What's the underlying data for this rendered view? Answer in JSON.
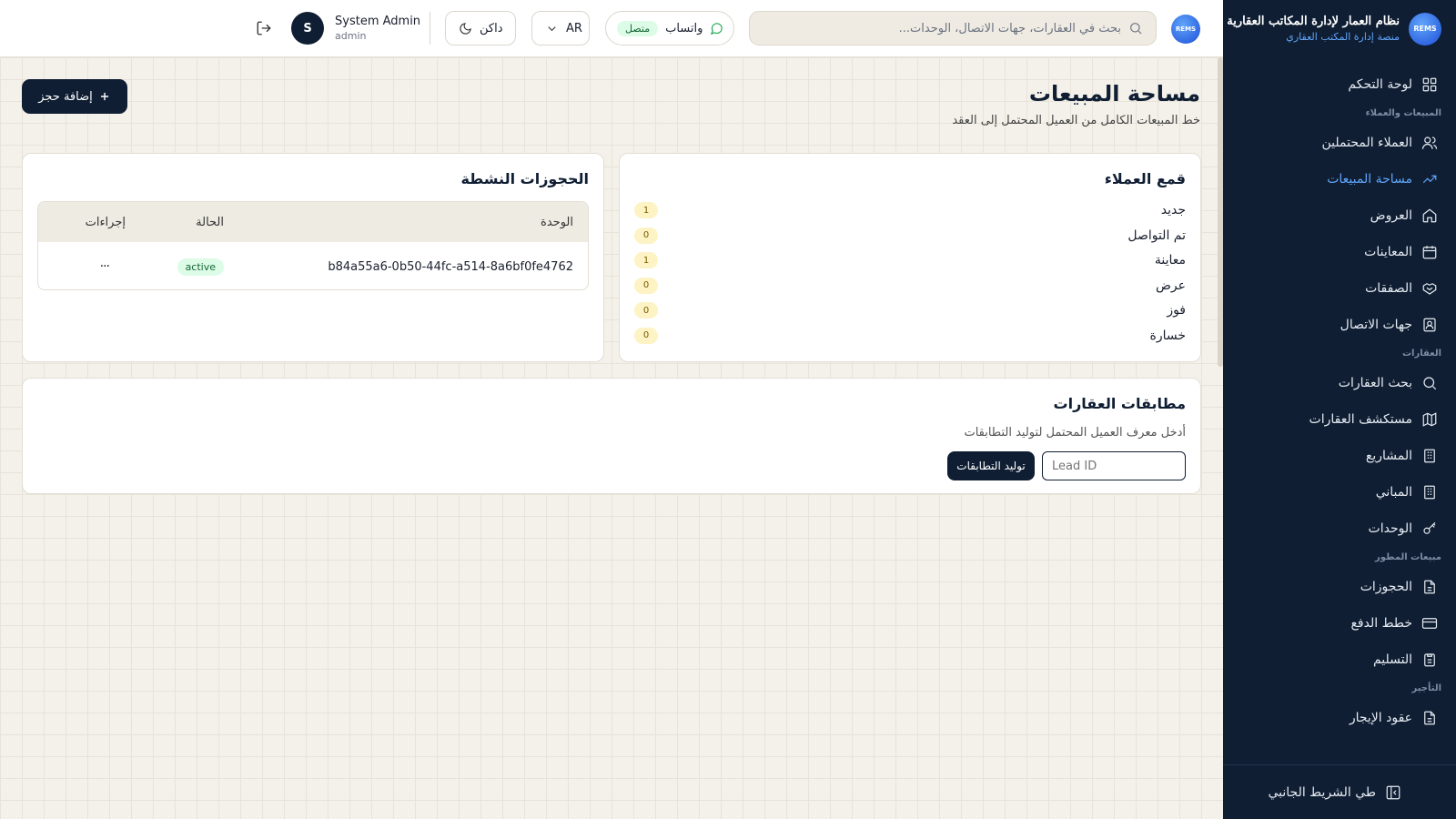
{
  "brand": {
    "logo_text": "REMS",
    "name": "نظام العمار لإدارة المكاتب العقارية",
    "subtitle": "منصة إدارة المكتب العقاري"
  },
  "sidebar": {
    "items": [
      {
        "label": "لوحة التحكم",
        "icon": "grid-icon"
      },
      {
        "section": "المبيعات والعملاء"
      },
      {
        "label": "العملاء المحتملين",
        "icon": "users-icon"
      },
      {
        "label": "مساحة المبيعات",
        "icon": "trending-up-icon",
        "active": true
      },
      {
        "label": "العروض",
        "icon": "home-icon"
      },
      {
        "label": "المعاينات",
        "icon": "calendar-icon"
      },
      {
        "label": "الصفقات",
        "icon": "handshake-icon"
      },
      {
        "label": "جهات الاتصال",
        "icon": "contact-icon"
      },
      {
        "section": "العقارات"
      },
      {
        "label": "بحث العقارات",
        "icon": "search-icon"
      },
      {
        "label": "مستكشف العقارات",
        "icon": "map-icon"
      },
      {
        "label": "المشاريع",
        "icon": "building-icon"
      },
      {
        "label": "المباني",
        "icon": "building-icon"
      },
      {
        "label": "الوحدات",
        "icon": "key-icon"
      },
      {
        "section": "مبيعات المطور"
      },
      {
        "label": "الحجوزات",
        "icon": "file-icon"
      },
      {
        "label": "خطط الدفع",
        "icon": "credit-card-icon"
      },
      {
        "label": "التسليم",
        "icon": "clipboard-icon"
      },
      {
        "section": "التأجير"
      },
      {
        "label": "عقود الإيجار",
        "icon": "file-icon"
      }
    ],
    "collapse_label": "طي الشريط الجانبي"
  },
  "topbar": {
    "search_placeholder": "بحث في العقارات، جهات الاتصال، الوحدات...",
    "whatsapp_label": "واتساب",
    "whatsapp_status": "متصل",
    "language": "AR",
    "theme_label": "داكن",
    "user": {
      "initial": "S",
      "name": "System Admin",
      "role": "admin"
    }
  },
  "page": {
    "title": "مساحة المبيعات",
    "subtitle": "خط المبيعات الكامل من العميل المحتمل إلى العقد",
    "add_button": "إضافة حجز"
  },
  "funnel": {
    "title": "قمع العملاء",
    "stages": [
      {
        "label": "جديد",
        "count": "1"
      },
      {
        "label": "تم التواصل",
        "count": "0"
      },
      {
        "label": "معاينة",
        "count": "1"
      },
      {
        "label": "عرض",
        "count": "0"
      },
      {
        "label": "فوز",
        "count": "0"
      },
      {
        "label": "خسارة",
        "count": "0"
      }
    ]
  },
  "reservations": {
    "title": "الحجوزات النشطة",
    "columns": {
      "unit": "الوحدة",
      "status": "الحالة",
      "actions": "إجراءات"
    },
    "rows": [
      {
        "unit": "b84a55a6-0b50-44fc-a514-8a6bf0fe4762",
        "status": "active",
        "actions": "···"
      }
    ]
  },
  "matches": {
    "title": "مطابقات العقارات",
    "description": "أدخل معرف العميل المحتمل لتوليد التطابقات",
    "input_placeholder": "Lead ID",
    "button": "توليد التطابقات"
  },
  "colors": {
    "sidebar_bg": "#0f1e33",
    "accent": "#60a5fa",
    "page_bg": "#f4f1ea",
    "success": "#166534",
    "count_badge": "#fdf3c4"
  }
}
